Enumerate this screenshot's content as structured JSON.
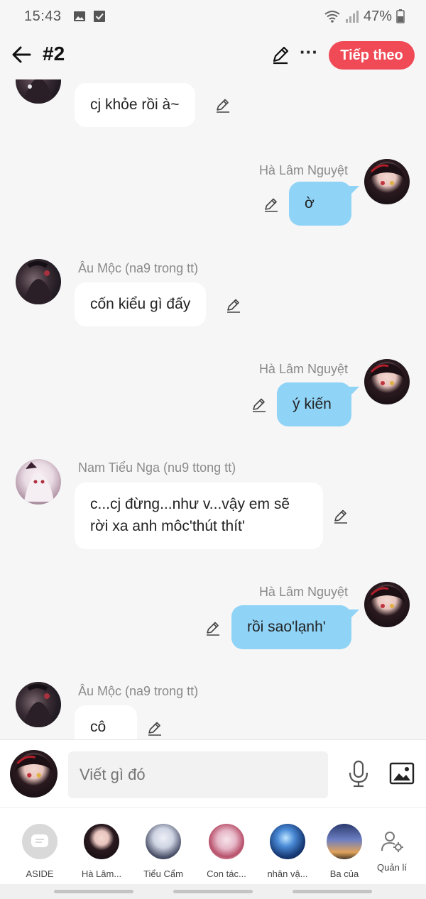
{
  "status_bar": {
    "time": "15:43",
    "battery": "47%"
  },
  "header": {
    "title": "#2",
    "next_label": "Tiếp theo"
  },
  "messages": [
    {
      "text": "cj khỏe rồi à~"
    },
    {
      "sender": "Hà Lâm Nguyệt",
      "text": "ờ"
    },
    {
      "sender": "Âu Mộc (na9 trong tt)",
      "text": "cốn kiểu gì đấy"
    },
    {
      "sender": "Hà Lâm Nguyệt",
      "text": "ý kiến"
    },
    {
      "sender": "Nam Tiểu Nga (nu9 ttong tt)",
      "line1": "c...cj đừng...như v...vậy em sẽ",
      "line2": "rời xa anh môc'thút thít'"
    },
    {
      "sender": "Hà Lâm Nguyệt",
      "text": "rồi sao'lạnh'"
    },
    {
      "sender": "Âu Mộc (na9 trong tt)",
      "text": "cô"
    }
  ],
  "composer": {
    "placeholder": "Viết gì đó"
  },
  "strip": [
    {
      "label": "ASIDE",
      "icon": "aside-icon"
    },
    {
      "label": "Hà Lâm..."
    },
    {
      "label": "Tiểu Cẩm"
    },
    {
      "label": "Con tác..."
    },
    {
      "label": "nhân vậ..."
    },
    {
      "label": "Ba của"
    },
    {
      "label": "Quản lí",
      "icon": "manage-user-gear-icon"
    }
  ],
  "colors": {
    "accent": "#f04a56",
    "my_bubble": "#8fd3f7",
    "other_bubble": "#ffffff",
    "background": "#f6f6f6"
  }
}
